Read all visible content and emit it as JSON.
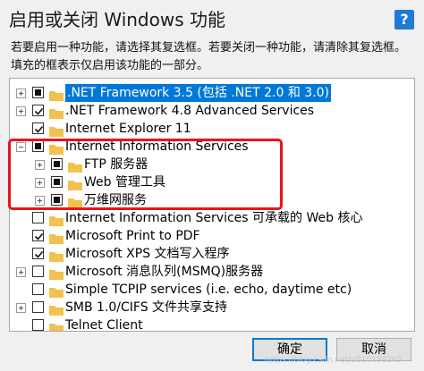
{
  "title": "启用或关闭 Windows 功能",
  "help": "?",
  "description": "若要启用一种功能，请选择其复选框。若要关闭一种功能，请清除其复选框。填充的框表示仅启用该功能的一部分。",
  "features": [
    {
      "label": ".NET Framework 3.5 (包括 .NET 2.0 和 3.0)",
      "expander": "+",
      "state": "partial",
      "selected": true
    },
    {
      "label": ".NET Framework 4.8 Advanced Services",
      "expander": "+",
      "state": "checked"
    },
    {
      "label": "Internet Explorer 11",
      "expander": "",
      "state": "checked"
    },
    {
      "label": "Internet Information Services",
      "expander": "-",
      "state": "partial"
    },
    {
      "label": "FTP 服务器",
      "expander": "+",
      "state": "partial"
    },
    {
      "label": "Web 管理工具",
      "expander": "+",
      "state": "partial"
    },
    {
      "label": "万维网服务",
      "expander": "+",
      "state": "partial"
    },
    {
      "label": "Internet Information Services 可承载的 Web 核心",
      "expander": "",
      "state": "unchecked"
    },
    {
      "label": "Microsoft Print to PDF",
      "expander": "",
      "state": "checked"
    },
    {
      "label": "Microsoft XPS 文档写入程序",
      "expander": "",
      "state": "checked"
    },
    {
      "label": "Microsoft 消息队列(MSMQ)服务器",
      "expander": "+",
      "state": "unchecked"
    },
    {
      "label": "Simple TCPIP services (i.e. echo, daytime etc)",
      "expander": "",
      "state": "unchecked"
    },
    {
      "label": "SMB 1.0/CIFS 文件共享支持",
      "expander": "+",
      "state": "unchecked"
    },
    {
      "label": "Telnet Client",
      "expander": "",
      "state": "unchecked"
    }
  ],
  "buttons": {
    "ok": "确定",
    "cancel": "取消"
  },
  "watermark": "https://blog.csdn.net/u010158265",
  "colors": {
    "folder": "#f2c14e",
    "selection": "#0078d7",
    "highlight": "#e8141c"
  }
}
